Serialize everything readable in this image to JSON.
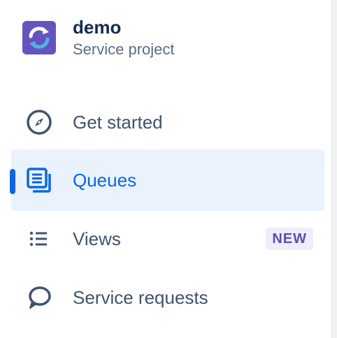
{
  "project": {
    "name": "demo",
    "type": "Service project"
  },
  "nav": {
    "items": [
      {
        "label": "Get started",
        "icon": "compass-icon",
        "active": false
      },
      {
        "label": "Queues",
        "icon": "queues-icon",
        "active": true
      },
      {
        "label": "Views",
        "icon": "list-icon",
        "active": false,
        "badge": "NEW"
      },
      {
        "label": "Service requests",
        "icon": "speech-bubble-icon",
        "active": false
      }
    ]
  },
  "colors": {
    "accent": "#0c66e4",
    "active_bg": "#e9f2fd",
    "avatar_bg": "#6554c0",
    "badge_bg": "#efecfb",
    "badge_text": "#5e4db2",
    "text_primary": "#172b4d",
    "text_secondary": "#5e6c84",
    "nav_text": "#42526e"
  }
}
